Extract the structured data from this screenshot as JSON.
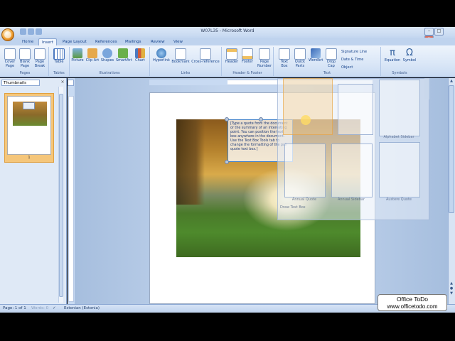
{
  "window": {
    "title": "W07L35 - Microsoft Word"
  },
  "tabs": [
    "Home",
    "Insert",
    "Page Layout",
    "References",
    "Mailings",
    "Review",
    "View"
  ],
  "active_tab": "Insert",
  "ribbon": {
    "pages": {
      "label": "Pages",
      "buttons": [
        "Cover Page",
        "Blank Page",
        "Page Break"
      ]
    },
    "tables": {
      "label": "Tables",
      "buttons": [
        "Table"
      ]
    },
    "illustrations": {
      "label": "Illustrations",
      "buttons": [
        "Picture",
        "Clip Art",
        "Shapes",
        "SmartArt",
        "Chart"
      ]
    },
    "links": {
      "label": "Links",
      "buttons": [
        "Hyperlink",
        "Bookmark",
        "Cross-reference"
      ]
    },
    "header_footer": {
      "label": "Header & Footer",
      "buttons": [
        "Header",
        "Footer",
        "Page Number"
      ]
    },
    "text": {
      "label": "Text",
      "buttons": [
        "Text Box",
        "Quick Parts",
        "WordArt",
        "Drop Cap"
      ],
      "small": [
        "Signature Line",
        "Date & Time",
        "Object"
      ]
    },
    "symbols": {
      "label": "Symbols",
      "buttons": [
        "Equation",
        "Symbol"
      ]
    }
  },
  "thumbnails": {
    "header": "Thumbnails",
    "page_number": "1"
  },
  "pull_quote": "[Type a quote from the document or the summary of an interesting point. You can position the text box anywhere in the document. Use the Text Box Tools tab to change the formatting of the pull quote text box.]",
  "gallery": {
    "items": [
      "Alphabet Sidebar",
      "Annual Quote",
      "Annual Sidebar",
      "Austere Quote"
    ],
    "bottom_label": "Draw Text Box"
  },
  "status": {
    "page": "Page: 1 of 1",
    "words": "Words: 0",
    "language": "Estonian (Estonia)"
  },
  "watermark": {
    "line1": "Office ToDo",
    "line2": "www.officetodo.com"
  },
  "colors": {
    "ribbon": "#dbe7f7",
    "accent": "#15428b",
    "selection": "#f5c67a"
  }
}
